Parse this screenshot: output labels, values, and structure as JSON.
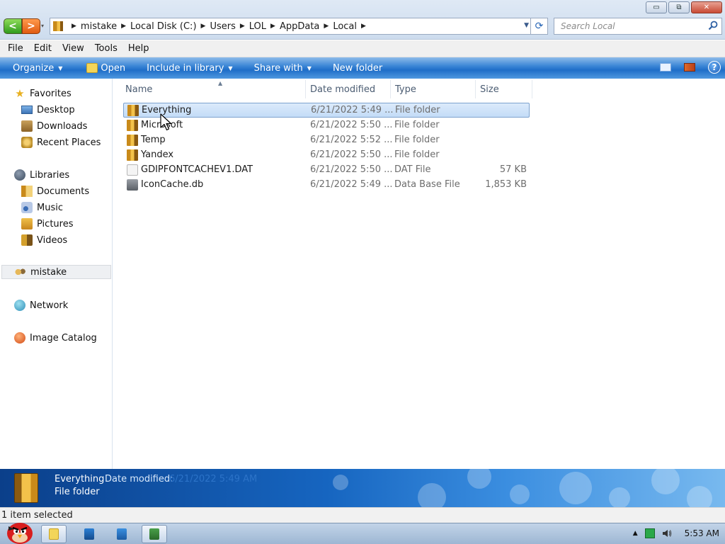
{
  "window": {
    "minimize_glyph": "▭",
    "maximize_glyph": "⧉",
    "close_glyph": "✕"
  },
  "nav": {
    "back_glyph": "<",
    "forward_glyph": ">",
    "history_glyph": "▾"
  },
  "address": {
    "crumbs": [
      "mistake",
      "Local Disk (C:)",
      "Users",
      "LOL",
      "AppData",
      "Local"
    ],
    "dropdown_glyph": "▼",
    "refresh_glyph": "⟳"
  },
  "search": {
    "placeholder": "Search Local"
  },
  "menubar": {
    "items": [
      "File",
      "Edit",
      "View",
      "Tools",
      "Help"
    ]
  },
  "toolbar": {
    "organize": "Organize",
    "open": "Open",
    "include_in_library": "Include in library",
    "share_with": "Share with",
    "new_folder": "New folder",
    "help_glyph": "?"
  },
  "sidebar": {
    "favorites": "Favorites",
    "desktop": "Desktop",
    "downloads": "Downloads",
    "recent_places": "Recent Places",
    "libraries": "Libraries",
    "documents": "Documents",
    "music": "Music",
    "pictures": "Pictures",
    "videos": "Videos",
    "user": "mistake",
    "network": "Network",
    "image_catalog": "Image Catalog"
  },
  "columns": {
    "name": "Name",
    "date_modified": "Date modified",
    "type": "Type",
    "size": "Size"
  },
  "files": [
    {
      "name": "Everything",
      "date": "6/21/2022 5:49 ...",
      "type": "File folder",
      "size": "",
      "icon": "folder-icon",
      "selected": true
    },
    {
      "name": "Microsoft",
      "date": "6/21/2022 5:50 ...",
      "type": "File folder",
      "size": "",
      "icon": "folder-icon",
      "selected": false
    },
    {
      "name": "Temp",
      "date": "6/21/2022 5:52 ...",
      "type": "File folder",
      "size": "",
      "icon": "folder-icon",
      "selected": false
    },
    {
      "name": "Yandex",
      "date": "6/21/2022 5:50 ...",
      "type": "File folder",
      "size": "",
      "icon": "folder-icon",
      "selected": false
    },
    {
      "name": "GDIPFONTCACHEV1.DAT",
      "date": "6/21/2022 5:50 ...",
      "type": "DAT File",
      "size": "57 KB",
      "icon": "dat-file-icon",
      "selected": false
    },
    {
      "name": "IconCache.db",
      "date": "6/21/2022 5:49 ...",
      "type": "Data Base File",
      "size": "1,853 KB",
      "icon": "database-file-icon",
      "selected": false
    }
  ],
  "details": {
    "name": "Everything",
    "date_label": "Date modified:",
    "date_value": "6/21/2022 5:49 AM",
    "type": "File folder"
  },
  "status": {
    "text": "1 item selected"
  },
  "taskbar": {
    "clock": "5:53 AM"
  },
  "colors": {
    "command_bar": "#2a78cf",
    "selection": "#c9defa",
    "details_pane": "#1665c0"
  }
}
